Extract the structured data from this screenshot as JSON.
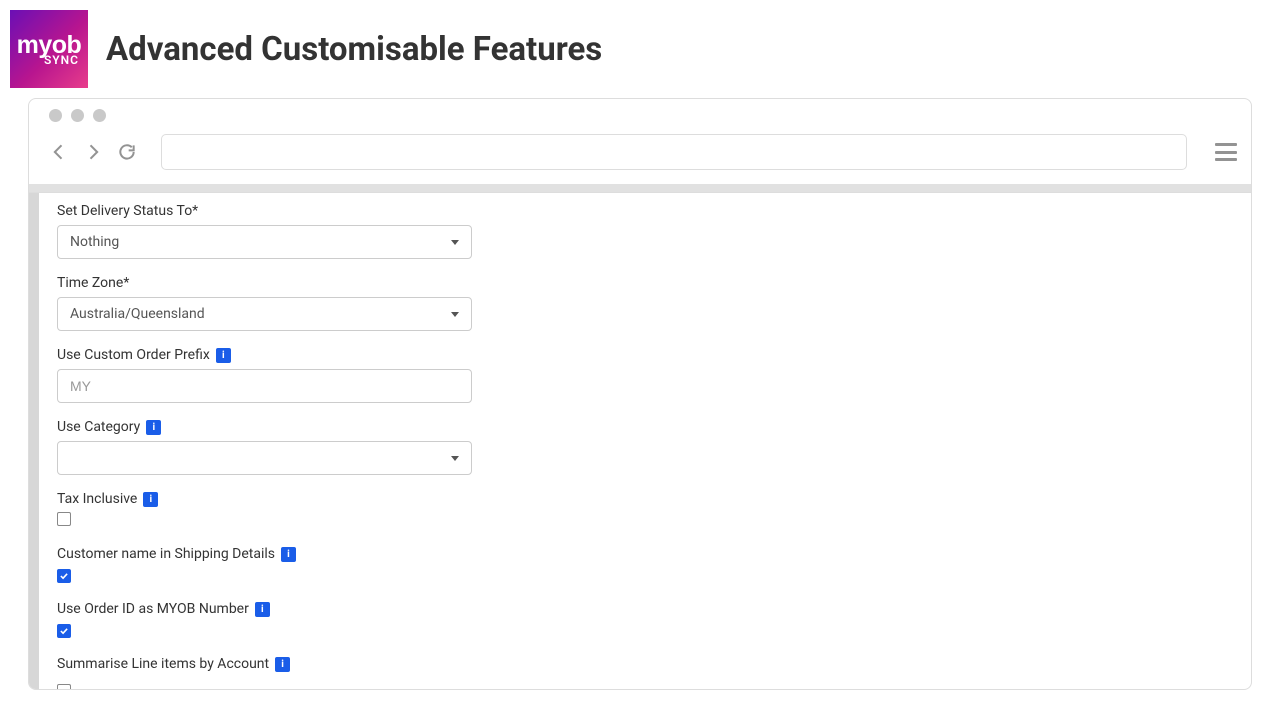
{
  "logo": {
    "top": "myob",
    "bottom": "SYNC"
  },
  "page_title": "Advanced Customisable Features",
  "url_bar": {
    "value": ""
  },
  "form": {
    "delivery_status": {
      "label": "Set Delivery Status To*",
      "value": "Nothing"
    },
    "time_zone": {
      "label": "Time Zone*",
      "value": "Australia/Queensland"
    },
    "custom_prefix": {
      "label": "Use Custom Order Prefix",
      "placeholder": "MY",
      "value": ""
    },
    "use_category": {
      "label": "Use Category",
      "value": ""
    },
    "tax_inclusive": {
      "label": "Tax Inclusive",
      "checked": false
    },
    "customer_name_shipping": {
      "label": "Customer name in Shipping Details",
      "checked": true
    },
    "order_id_myob": {
      "label": "Use Order ID as MYOB Number",
      "checked": true
    },
    "summarise_lines": {
      "label": "Summarise Line items by Account",
      "checked": false
    }
  },
  "info_glyph": "i",
  "colors": {
    "accent": "#1a5de8"
  }
}
